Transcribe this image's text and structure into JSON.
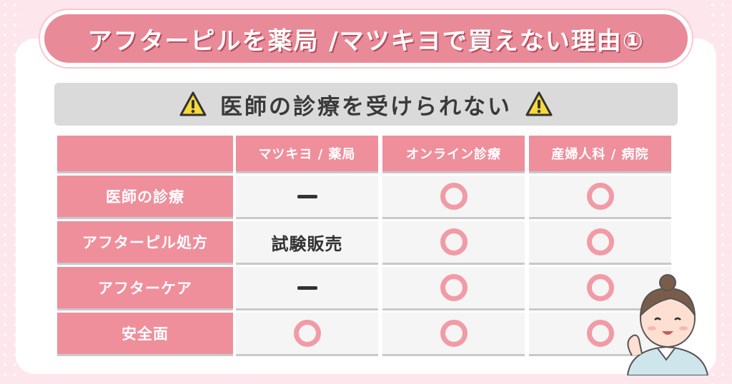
{
  "title": "アフターピルを薬局 /マツキヨで買えない理由①",
  "subtitle": "医師の診療を受けられない",
  "table": {
    "columns": [
      "マツキヨ / 薬局",
      "オンライン診療",
      "産婦人科 / 病院"
    ],
    "rows": [
      {
        "label": "医師の診療",
        "values": [
          "dash",
          "circle",
          "circle"
        ]
      },
      {
        "label": "アフターピル処方",
        "values": [
          "試験販売",
          "circle",
          "circle"
        ]
      },
      {
        "label": "アフターケア",
        "values": [
          "dash",
          "circle",
          "circle"
        ]
      },
      {
        "label": "安全面",
        "values": [
          "circle",
          "circle",
          "circle"
        ]
      }
    ]
  },
  "icons": {
    "warning": "warning-icon",
    "circle": "circle-mark-icon",
    "dash": "dash-mark-icon",
    "character": "nurse-character-icon"
  },
  "colors": {
    "background": "#fde6ec",
    "accent": "#e98a98",
    "header_cell": "#ef8f9c",
    "value_cell": "#f5f5f5",
    "circle_mark": "#f19ba6",
    "subtitle_bar": "#dadada"
  }
}
